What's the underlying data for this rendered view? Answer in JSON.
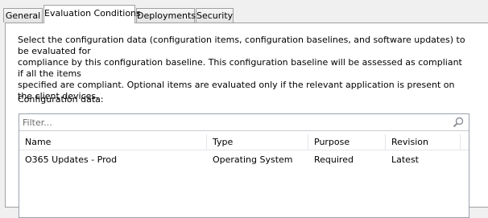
{
  "tabs": [
    {
      "label": "General",
      "active": false
    },
    {
      "label": "Evaluation Conditions",
      "active": true
    },
    {
      "label": "Deployments",
      "active": false
    },
    {
      "label": "Security",
      "active": false
    }
  ],
  "description": "Select the configuration data (configuration items, configuration baselines, and software updates) to be evaluated for\ncompliance by this configuration baseline. This configuration baseline will be assessed as compliant if all the items\nspecified are compliant. Optional items are evaluated only if the relevant application is present on  the client devices.",
  "config_label": "Configuration data:",
  "filter": {
    "placeholder": "Filter...",
    "value": "",
    "icon": "search-icon"
  },
  "columns": [
    "Name",
    "Type",
    "Purpose",
    "Revision"
  ],
  "rows": [
    {
      "name": "O365 Updates - Prod",
      "type": "Operating System",
      "purpose": "Required",
      "revision": "Latest"
    }
  ]
}
